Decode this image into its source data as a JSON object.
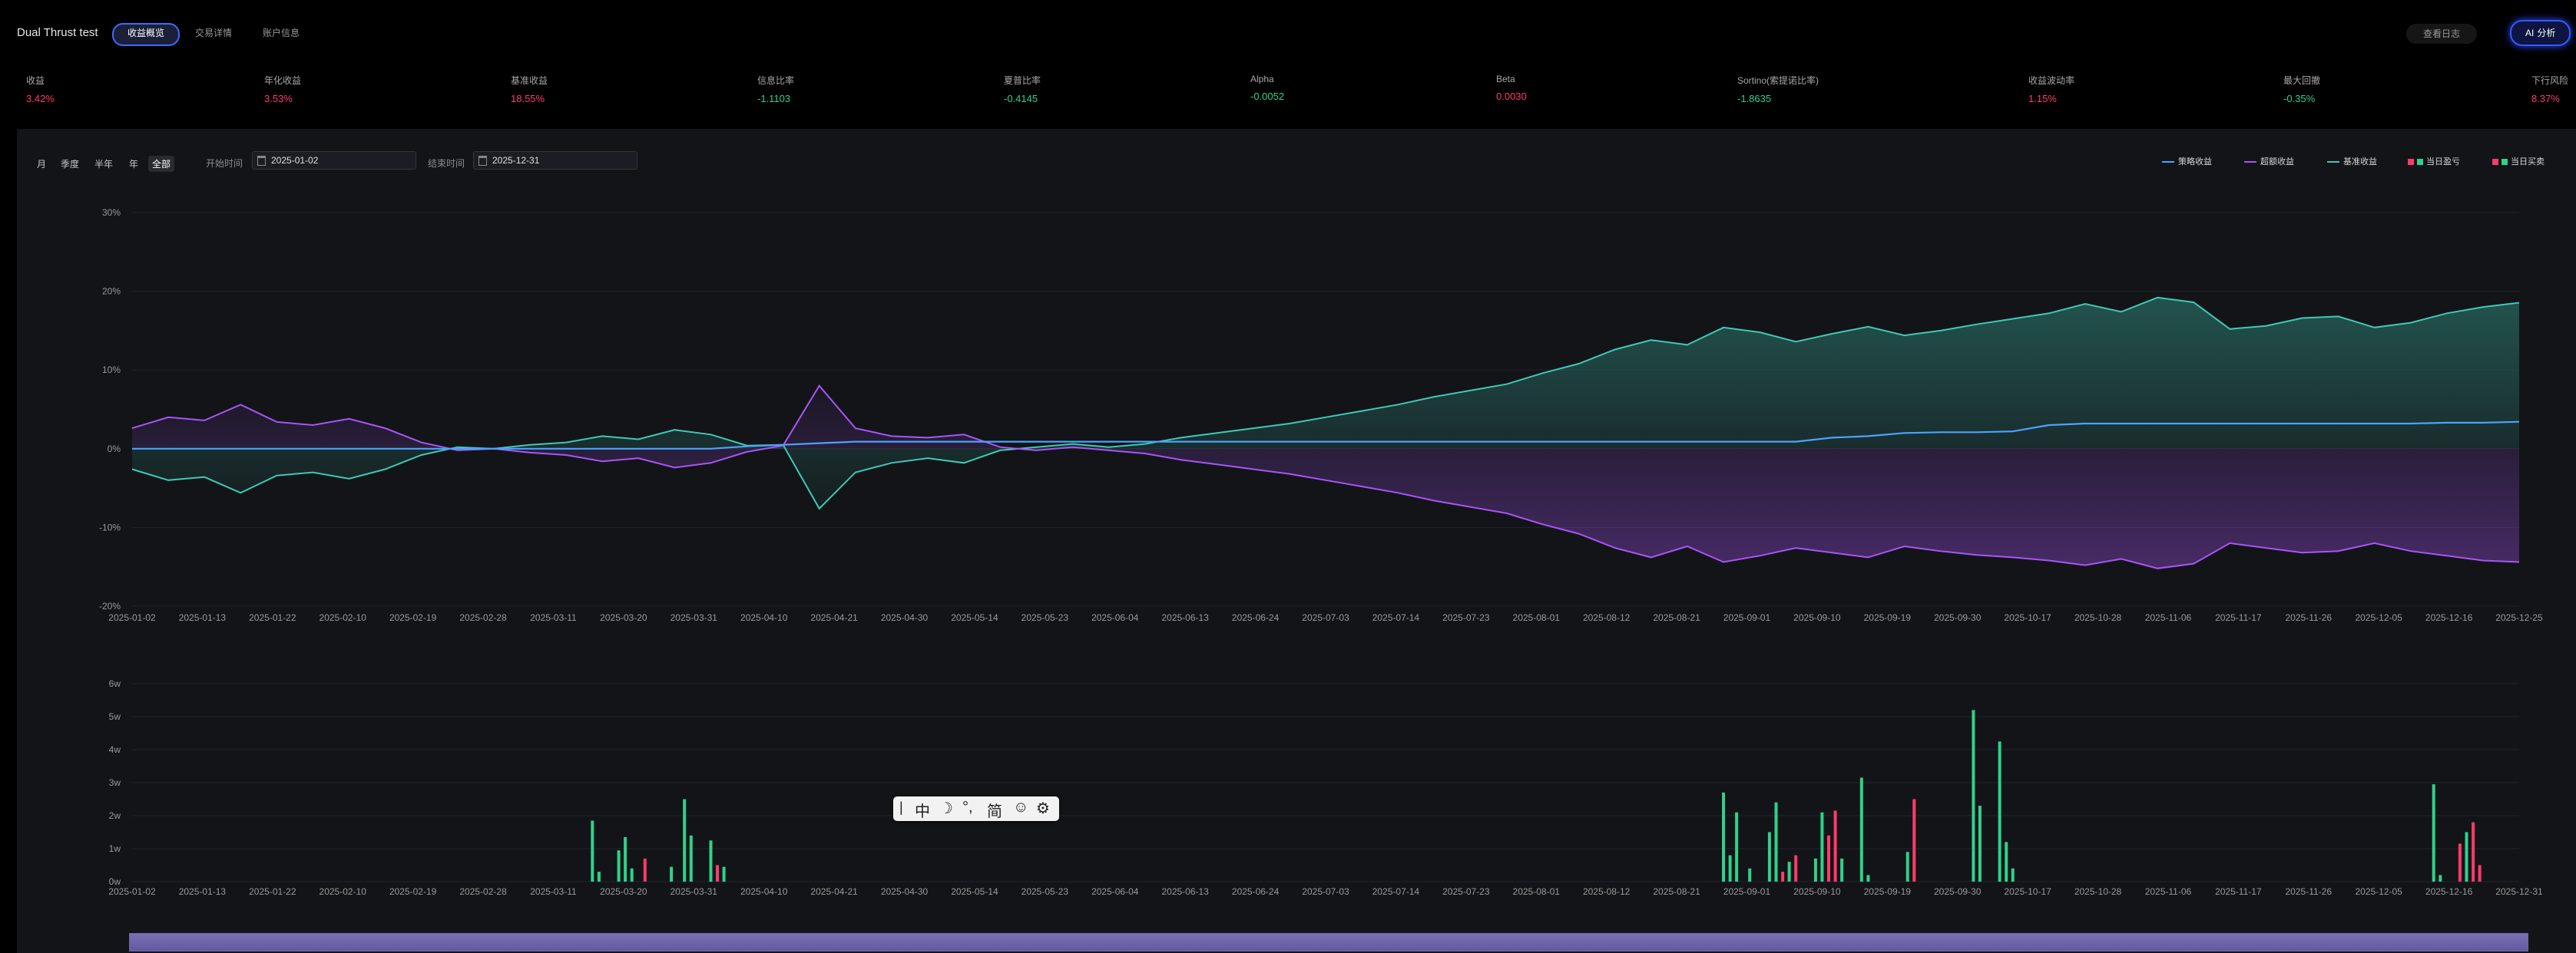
{
  "header": {
    "title": "Dual Thrust test",
    "tabs": [
      "收益概览",
      "交易详情",
      "账户信息"
    ],
    "active_tab": 0,
    "log_button": "查看日志",
    "analyze_button": "分析"
  },
  "stats": [
    {
      "label": "收益",
      "value": "3.42%",
      "color": "#ff3b6b"
    },
    {
      "label": "年化收益",
      "value": "3.53%",
      "color": "#ff3b6b"
    },
    {
      "label": "基准收益",
      "value": "18.55%",
      "color": "#ff3b6b"
    },
    {
      "label": "信息比率",
      "value": "-1.1103",
      "color": "#2fd28a"
    },
    {
      "label": "夏普比率",
      "value": "-0.4145",
      "color": "#2fd28a"
    },
    {
      "label": "Alpha",
      "value": "-0.0052",
      "color": "#2fd28a"
    },
    {
      "label": "Beta",
      "value": "0.0030",
      "color": "#ff3b6b"
    },
    {
      "label": "Sortino(索提诺比率)",
      "value": "-1.8635",
      "color": "#2fd28a"
    },
    {
      "label": "收益波动率",
      "value": "1.15%",
      "color": "#ff3b6b"
    },
    {
      "label": "最大回撤",
      "value": "-0.35%",
      "color": "#2fd28a"
    },
    {
      "label": "下行风险",
      "value": "8.37%",
      "color": "#ff3b6b"
    }
  ],
  "filters": {
    "periods": [
      "月",
      "季度",
      "半年",
      "年",
      "全部"
    ],
    "active_period": 4,
    "start_label": "开始时间",
    "start_value": "2025-01-02",
    "end_label": "结束时间",
    "end_value": "2025-12-31"
  },
  "legend": [
    {
      "label": "策略收益",
      "type": "line",
      "color": "#4aa3ff"
    },
    {
      "label": "超额收益",
      "type": "line",
      "color": "#a855f7"
    },
    {
      "label": "基准收益",
      "type": "line",
      "color": "#3fc9b4"
    },
    {
      "label": "当日盈亏",
      "type": "square",
      "colors": [
        "#ff3b6b",
        "#2fd28a"
      ]
    },
    {
      "label": "当日买卖",
      "type": "square",
      "colors": [
        "#ff3b6b",
        "#2fd28a"
      ]
    }
  ],
  "ime_toolbar": [
    "中",
    "简"
  ],
  "chart_data": [
    {
      "type": "line",
      "y_ticks": [
        "30%",
        "20%",
        "10%",
        "0%",
        "-10%",
        "-20%"
      ],
      "ylim": [
        -20,
        30
      ],
      "x_ticks": [
        "2025-01-02",
        "2025-01-13",
        "2025-01-22",
        "2025-02-10",
        "2025-02-19",
        "2025-02-28",
        "2025-03-11",
        "2025-03-20",
        "2025-03-31",
        "2025-04-10",
        "2025-04-21",
        "2025-04-30",
        "2025-05-14",
        "2025-05-23",
        "2025-06-04",
        "2025-06-13",
        "2025-06-24",
        "2025-07-03",
        "2025-07-14",
        "2025-07-23",
        "2025-08-01",
        "2025-08-12",
        "2025-08-21",
        "2025-09-01",
        "2025-09-10",
        "2025-09-19",
        "2025-09-30",
        "2025-10-17",
        "2025-10-28",
        "2025-11-06",
        "2025-11-17",
        "2025-11-26",
        "2025-12-05",
        "2025-12-16",
        "2025-12-25"
      ],
      "series": [
        {
          "name": "策略收益",
          "color": "#4aa3ff",
          "values": [
            0,
            0,
            0,
            0,
            0,
            0,
            0,
            0,
            0,
            0,
            0,
            0,
            0,
            0,
            0,
            0,
            0,
            0.3,
            0.5,
            0.7,
            0.9,
            0.9,
            0.9,
            0.9,
            0.9,
            0.9,
            0.9,
            0.9,
            0.9,
            0.9,
            0.9,
            0.9,
            0.9,
            0.9,
            0.9,
            0.9,
            0.9,
            0.9,
            0.9,
            0.9,
            0.9,
            0.9,
            0.9,
            0.9,
            0.9,
            0.9,
            0.9,
            1.4,
            1.6,
            2.0,
            2.1,
            2.1,
            2.2,
            3.0,
            3.2,
            3.2,
            3.2,
            3.2,
            3.2,
            3.2,
            3.2,
            3.2,
            3.2,
            3.2,
            3.3,
            3.3,
            3.42
          ]
        },
        {
          "name": "超额收益",
          "color": "#a855f7",
          "values": [
            2.6,
            4.0,
            3.6,
            5.6,
            3.4,
            3.0,
            3.8,
            2.6,
            0.8,
            -0.2,
            0.0,
            -0.5,
            -0.8,
            -1.6,
            -1.2,
            -2.4,
            -1.8,
            -0.4,
            0.4,
            8.0,
            2.6,
            1.6,
            1.4,
            1.8,
            0.2,
            -0.2,
            0.2,
            -0.2,
            -0.6,
            -1.4,
            -2.0,
            -2.6,
            -3.2,
            -4.0,
            -4.8,
            -5.6,
            -6.6,
            -7.4,
            -8.2,
            -9.6,
            -10.8,
            -12.6,
            -13.8,
            -12.4,
            -14.4,
            -13.6,
            -12.6,
            -13.2,
            -13.8,
            -12.4,
            -13.0,
            -13.5,
            -13.8,
            -14.2,
            -14.8,
            -14.0,
            -15.2,
            -14.6,
            -12.0,
            -12.6,
            -13.2,
            -13.0,
            -12.0,
            -13.0,
            -13.6,
            -14.2,
            -14.4
          ]
        },
        {
          "name": "基准收益",
          "color": "#3fc9b4",
          "values": [
            -2.6,
            -4.0,
            -3.6,
            -5.6,
            -3.4,
            -3.0,
            -3.8,
            -2.6,
            -0.8,
            0.2,
            0.0,
            0.5,
            0.8,
            1.6,
            1.2,
            2.4,
            1.8,
            0.4,
            0.5,
            -7.6,
            -3.0,
            -1.8,
            -1.2,
            -1.8,
            -0.2,
            0.2,
            0.6,
            0.2,
            0.6,
            1.4,
            2.0,
            2.6,
            3.2,
            4.0,
            4.8,
            5.6,
            6.6,
            7.4,
            8.2,
            9.6,
            10.8,
            12.6,
            13.8,
            13.2,
            15.4,
            14.8,
            13.6,
            14.6,
            15.5,
            14.4,
            15.0,
            15.8,
            16.5,
            17.2,
            18.4,
            17.4,
            19.2,
            18.6,
            15.2,
            15.6,
            16.6,
            16.8,
            15.4,
            16.0,
            17.2,
            18.0,
            18.55
          ]
        }
      ]
    },
    {
      "type": "bar",
      "y_ticks": [
        "6w",
        "5w",
        "4w",
        "3w",
        "2w",
        "1w",
        "0w"
      ],
      "ylim": [
        0,
        6
      ],
      "unit": "w",
      "x_ticks": [
        "2025-01-02",
        "2025-01-13",
        "2025-01-22",
        "2025-02-10",
        "2025-02-19",
        "2025-02-28",
        "2025-03-11",
        "2025-03-20",
        "2025-03-31",
        "2025-04-10",
        "2025-04-21",
        "2025-04-30",
        "2025-05-14",
        "2025-05-23",
        "2025-06-04",
        "2025-06-13",
        "2025-06-24",
        "2025-07-03",
        "2025-07-14",
        "2025-07-23",
        "2025-08-01",
        "2025-08-12",
        "2025-08-21",
        "2025-09-01",
        "2025-09-10",
        "2025-09-19",
        "2025-09-30",
        "2025-10-17",
        "2025-10-28",
        "2025-11-06",
        "2025-11-17",
        "2025-11-26",
        "2025-12-05",
        "2025-12-16",
        "2025-12-31"
      ],
      "colors": {
        "buy": "#2fd28a",
        "sell": "#ff3b6b"
      },
      "trades": [
        {
          "date": "2025-03-13",
          "value": 1.85,
          "side": "buy"
        },
        {
          "date": "2025-03-14",
          "value": 0.3,
          "side": "buy"
        },
        {
          "date": "2025-03-17",
          "value": 0.95,
          "side": "buy"
        },
        {
          "date": "2025-03-18",
          "value": 1.35,
          "side": "buy"
        },
        {
          "date": "2025-03-19",
          "value": 0.4,
          "side": "buy"
        },
        {
          "date": "2025-03-21",
          "value": 0.7,
          "side": "sell"
        },
        {
          "date": "2025-03-25",
          "value": 0.45,
          "side": "buy"
        },
        {
          "date": "2025-03-27",
          "value": 2.5,
          "side": "buy"
        },
        {
          "date": "2025-03-28",
          "value": 1.4,
          "side": "buy"
        },
        {
          "date": "2025-03-31",
          "value": 1.25,
          "side": "buy"
        },
        {
          "date": "2025-04-01",
          "value": 0.5,
          "side": "sell"
        },
        {
          "date": "2025-04-02",
          "value": 0.45,
          "side": "buy"
        },
        {
          "date": "2025-09-01",
          "value": 2.7,
          "side": "buy"
        },
        {
          "date": "2025-09-02",
          "value": 0.8,
          "side": "buy"
        },
        {
          "date": "2025-09-03",
          "value": 2.1,
          "side": "buy"
        },
        {
          "date": "2025-09-05",
          "value": 0.4,
          "side": "buy"
        },
        {
          "date": "2025-09-08",
          "value": 1.5,
          "side": "buy"
        },
        {
          "date": "2025-09-09",
          "value": 2.4,
          "side": "buy"
        },
        {
          "date": "2025-09-10",
          "value": 0.3,
          "side": "sell"
        },
        {
          "date": "2025-09-11",
          "value": 0.6,
          "side": "buy"
        },
        {
          "date": "2025-09-12",
          "value": 0.8,
          "side": "sell"
        },
        {
          "date": "2025-09-15",
          "value": 0.7,
          "side": "buy"
        },
        {
          "date": "2025-09-16",
          "value": 2.1,
          "side": "buy"
        },
        {
          "date": "2025-09-17",
          "value": 1.4,
          "side": "sell"
        },
        {
          "date": "2025-09-18",
          "value": 2.15,
          "side": "sell"
        },
        {
          "date": "2025-09-19",
          "value": 0.7,
          "side": "buy"
        },
        {
          "date": "2025-09-22",
          "value": 3.15,
          "side": "buy"
        },
        {
          "date": "2025-09-23",
          "value": 0.2,
          "side": "buy"
        },
        {
          "date": "2025-09-29",
          "value": 0.9,
          "side": "buy"
        },
        {
          "date": "2025-09-30",
          "value": 2.5,
          "side": "sell"
        },
        {
          "date": "2025-10-09",
          "value": 5.2,
          "side": "buy"
        },
        {
          "date": "2025-10-10",
          "value": 2.3,
          "side": "buy"
        },
        {
          "date": "2025-10-13",
          "value": 4.25,
          "side": "buy"
        },
        {
          "date": "2025-10-14",
          "value": 1.2,
          "side": "buy"
        },
        {
          "date": "2025-10-15",
          "value": 0.4,
          "side": "buy"
        },
        {
          "date": "2025-12-18",
          "value": 2.95,
          "side": "buy"
        },
        {
          "date": "2025-12-19",
          "value": 0.2,
          "side": "buy"
        },
        {
          "date": "2025-12-22",
          "value": 1.15,
          "side": "sell"
        },
        {
          "date": "2025-12-23",
          "value": 1.5,
          "side": "buy"
        },
        {
          "date": "2025-12-24",
          "value": 1.8,
          "side": "sell"
        },
        {
          "date": "2025-12-25",
          "value": 0.5,
          "side": "sell"
        }
      ]
    }
  ]
}
